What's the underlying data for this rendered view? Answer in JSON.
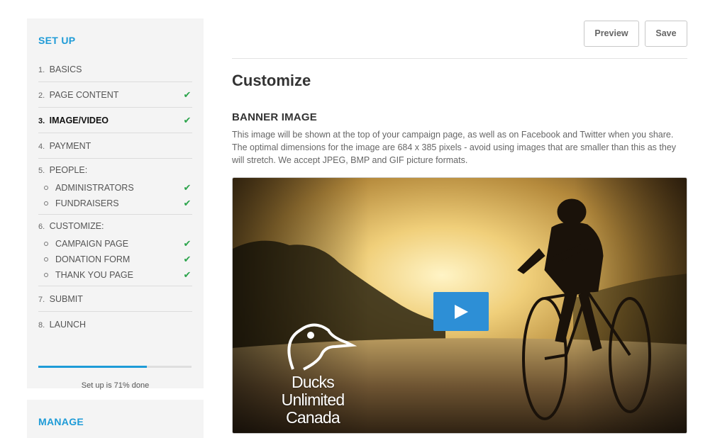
{
  "sidebar": {
    "heading": "SET UP",
    "items": [
      {
        "num": "1.",
        "label": "BASICS",
        "checked": false,
        "active": false
      },
      {
        "num": "2.",
        "label": "PAGE CONTENT",
        "checked": true,
        "active": false
      },
      {
        "num": "3.",
        "label": "IMAGE/VIDEO",
        "checked": true,
        "active": true
      },
      {
        "num": "4.",
        "label": "PAYMENT",
        "checked": false,
        "active": false
      }
    ],
    "people": {
      "num": "5.",
      "label": "PEOPLE:",
      "subs": [
        {
          "label": "ADMINISTRATORS",
          "checked": true
        },
        {
          "label": "FUNDRAISERS",
          "checked": true
        }
      ]
    },
    "customize": {
      "num": "6.",
      "label": "CUSTOMIZE:",
      "subs": [
        {
          "label": "CAMPAIGN PAGE",
          "checked": true
        },
        {
          "label": "DONATION FORM",
          "checked": true
        },
        {
          "label": "THANK YOU PAGE",
          "checked": true
        }
      ]
    },
    "tail_items": [
      {
        "num": "7.",
        "label": "SUBMIT"
      },
      {
        "num": "8.",
        "label": "LAUNCH"
      }
    ],
    "progress_fraction": 0.71,
    "progress_text": "Set up is 71% done",
    "check_glyph": "✔"
  },
  "manage": {
    "heading": "MANAGE"
  },
  "toolbar": {
    "preview_label": "Preview",
    "save_label": "Save"
  },
  "main": {
    "title": "Customize",
    "section_title": "BANNER IMAGE",
    "section_desc": "This image will be shown at the top of your campaign page, as well as on Facebook and Twitter when you share. The optimal dimensions for the image are 684 x 385 pixels - avoid using images that are smaller than this as they will stretch. We accept JPEG, BMP and GIF picture formats."
  },
  "banner": {
    "logo_line1": "Ducks Unlimited",
    "logo_line2": "Canada",
    "play_icon": "play-icon"
  },
  "colors": {
    "accent": "#1e9bd7",
    "check": "#2aa34a",
    "play": "#2d8fd6"
  }
}
